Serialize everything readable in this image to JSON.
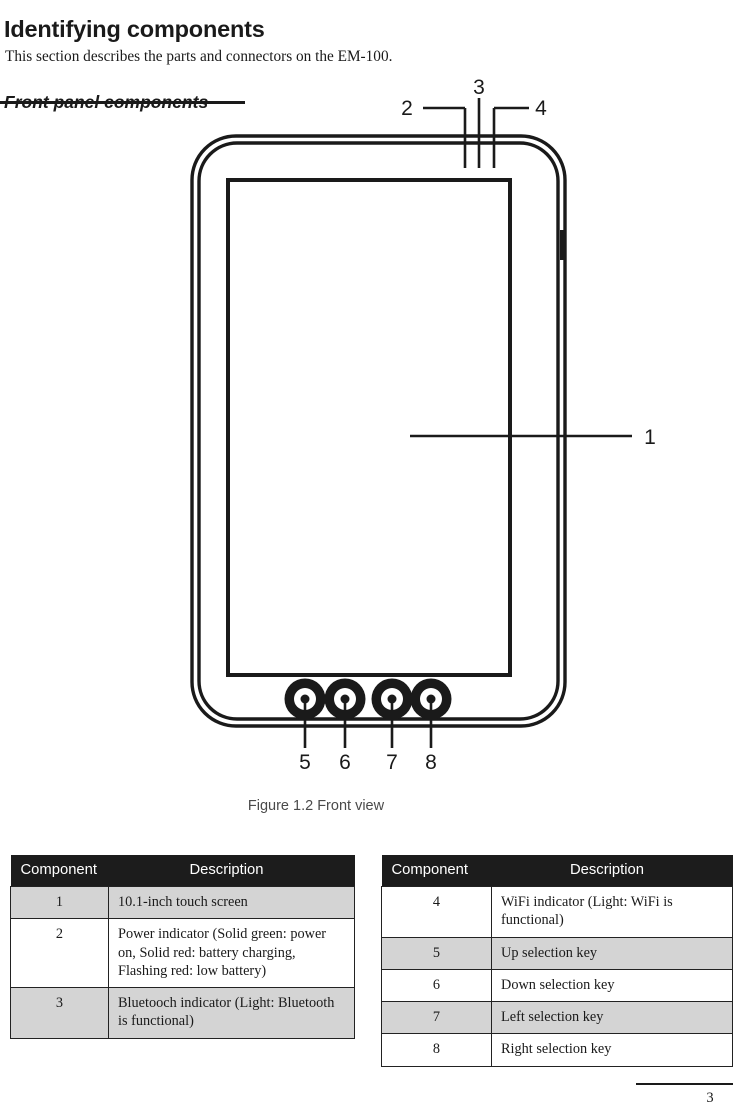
{
  "document": {
    "title": "Identifying components",
    "intro": "This section describes the parts and connectors on the EM-100.",
    "subtitle": "Front panel components",
    "page_number": "3"
  },
  "figure": {
    "caption": "Figure 1.2 Front view",
    "device_name": "EM-100 tablet front view",
    "callouts": [
      {
        "label": "1",
        "target": "touch-screen"
      },
      {
        "label": "2",
        "target": "power-indicator"
      },
      {
        "label": "3",
        "target": "bluetooth-indicator"
      },
      {
        "label": "4",
        "target": "wifi-indicator"
      },
      {
        "label": "5",
        "target": "up-selection-key"
      },
      {
        "label": "6",
        "target": "down-selection-key"
      },
      {
        "label": "7",
        "target": "left-selection-key"
      },
      {
        "label": "8",
        "target": "right-selection-key"
      }
    ]
  },
  "tables": {
    "left": {
      "headers": {
        "component": "Component",
        "description": "Description"
      },
      "rows": [
        {
          "component": "1",
          "description": "10.1-inch touch screen",
          "shaded": true
        },
        {
          "component": "2",
          "description": "Power indicator (Solid green: power on, Solid red: battery charging, Flashing red: low battery)",
          "shaded": false
        },
        {
          "component": "3",
          "description": "Bluetooch indicator (Light: Bluetooth is functional)",
          "shaded": true
        }
      ]
    },
    "right": {
      "headers": {
        "component": "Component",
        "description": "Description"
      },
      "rows": [
        {
          "component": "4",
          "description": "WiFi indicator (Light: WiFi is functional)",
          "shaded": false
        },
        {
          "component": "5",
          "description": "Up selection key",
          "shaded": true
        },
        {
          "component": "6",
          "description": "Down selection key",
          "shaded": false
        },
        {
          "component": "7",
          "description": "Left selection key",
          "shaded": true
        },
        {
          "component": "8",
          "description": "Right selection key",
          "shaded": false
        }
      ]
    }
  },
  "colors": {
    "ink": "#1a1a1a",
    "header_bg": "#1c1c1c",
    "header_text": "#ffffff",
    "row_shaded": "#d4d4d4",
    "row_plain": "#ffffff",
    "caption_text": "#4a4a4a"
  }
}
